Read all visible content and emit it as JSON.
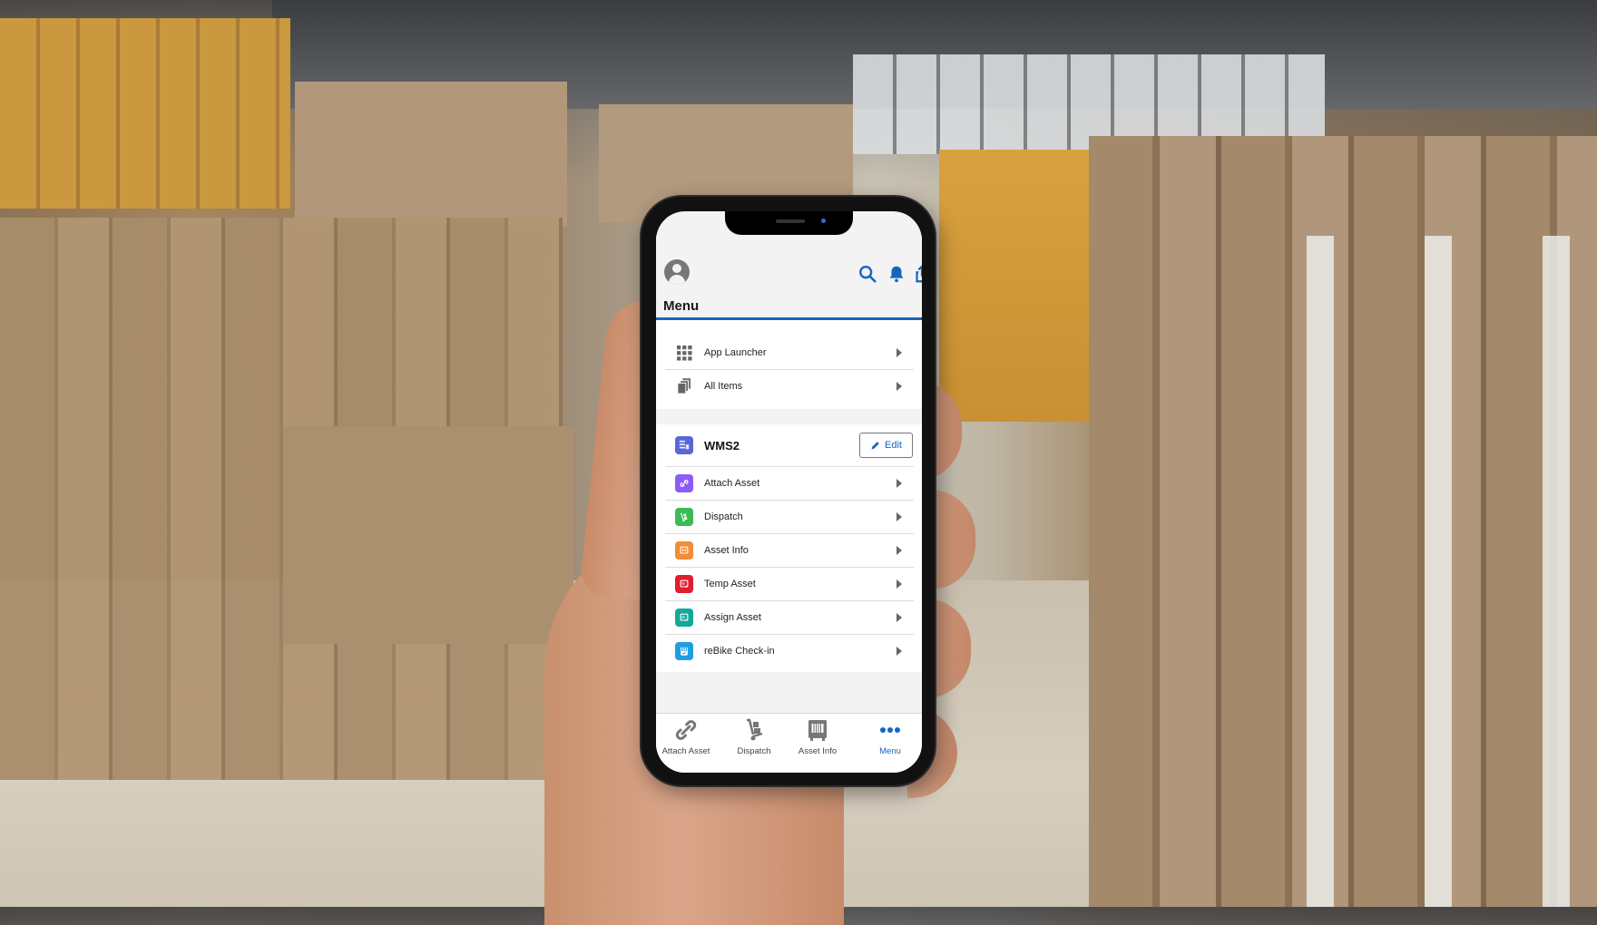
{
  "app": {
    "header": {
      "title": "Menu",
      "icons": [
        "user-avatar-icon",
        "search-icon",
        "bell-icon",
        "share-icon"
      ]
    },
    "accent_color": "#1565c0",
    "general_items": [
      {
        "label": "App Launcher",
        "icon": "app-grid-icon"
      },
      {
        "label": "All Items",
        "icon": "stacked-pages-icon"
      }
    ],
    "app_section": {
      "title": "WMS2",
      "icon": "wms-app-icon",
      "icon_color": "#5a67d8",
      "edit_label": "Edit",
      "items": [
        {
          "label": "Attach Asset",
          "icon": "link-icon",
          "color": "#8b5cf6"
        },
        {
          "label": "Dispatch",
          "icon": "hand-truck-icon",
          "color": "#3cba54"
        },
        {
          "label": "Asset Info",
          "icon": "safe-icon",
          "color": "#f28c38"
        },
        {
          "label": "Temp Asset",
          "icon": "temp-asset-icon",
          "color": "#e11d2f"
        },
        {
          "label": "Assign Asset",
          "icon": "assign-asset-icon",
          "color": "#14a89a"
        },
        {
          "label": "reBike Check-in",
          "icon": "checkin-icon",
          "color": "#1e9ee0"
        }
      ]
    },
    "bottom_nav": [
      {
        "label": "Attach Asset",
        "icon": "paperclip-icon",
        "active": false
      },
      {
        "label": "Dispatch",
        "icon": "hand-truck-icon",
        "active": false
      },
      {
        "label": "Asset Info",
        "icon": "safe-icon",
        "active": false
      },
      {
        "label": "Menu",
        "icon": "more-dots-icon",
        "active": true
      }
    ]
  }
}
